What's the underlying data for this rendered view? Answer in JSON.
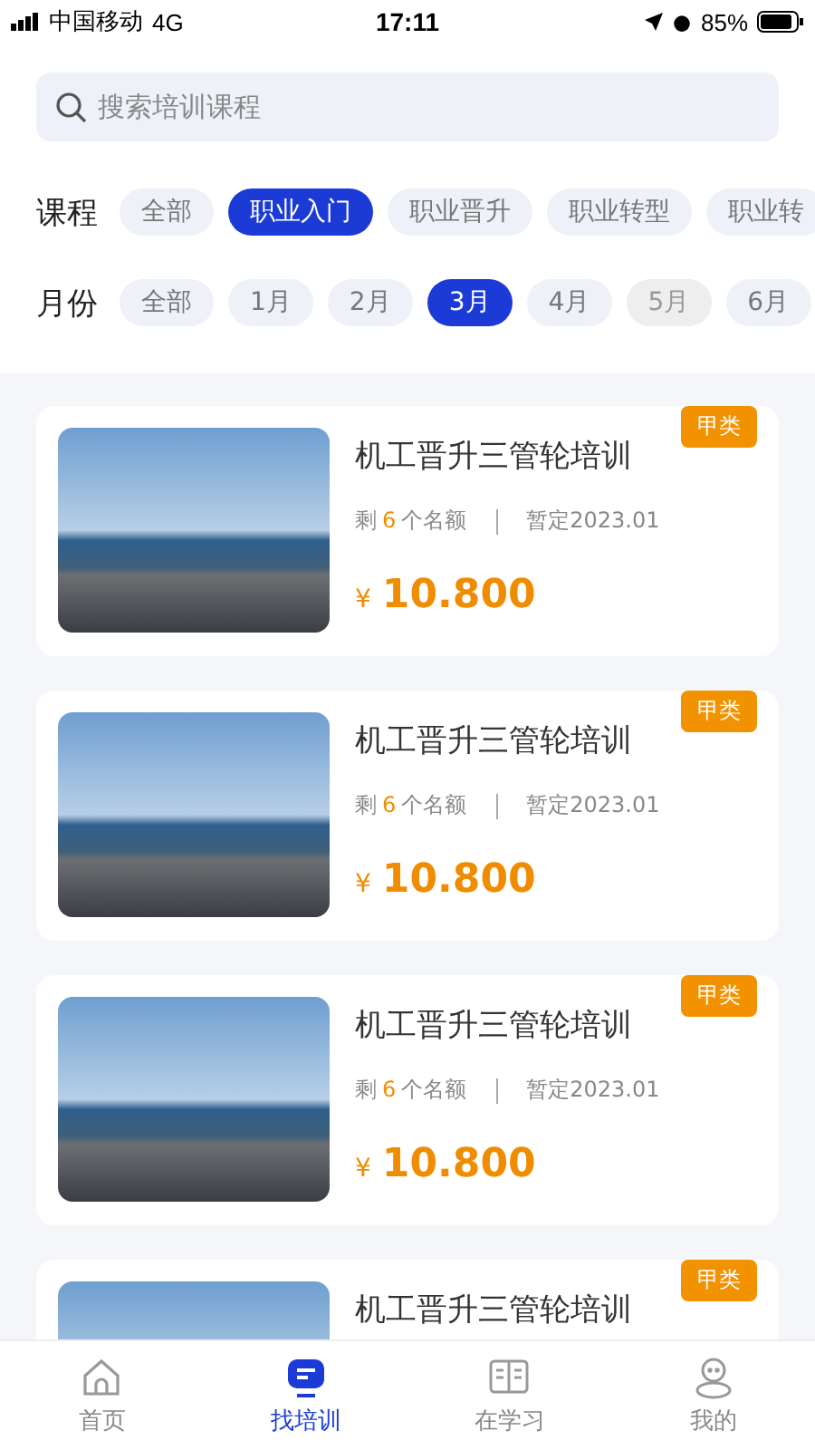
{
  "status_bar": {
    "carrier": "中国移动",
    "network": "4G",
    "time": "17:11",
    "battery": "85%"
  },
  "search": {
    "placeholder": "搜索培训课程"
  },
  "filters": [
    {
      "label": "课程",
      "options": [
        {
          "label": "全部",
          "selected": false,
          "disabled": false
        },
        {
          "label": "职业入门",
          "selected": true,
          "disabled": false
        },
        {
          "label": "职业晋升",
          "selected": false,
          "disabled": false
        },
        {
          "label": "职业转型",
          "selected": false,
          "disabled": false
        },
        {
          "label": "职业转",
          "selected": false,
          "disabled": false
        }
      ]
    },
    {
      "label": "月份",
      "options": [
        {
          "label": "全部",
          "selected": false,
          "disabled": false
        },
        {
          "label": "1月",
          "selected": false,
          "disabled": false
        },
        {
          "label": "2月",
          "selected": false,
          "disabled": false
        },
        {
          "label": "3月",
          "selected": true,
          "disabled": false
        },
        {
          "label": "4月",
          "selected": false,
          "disabled": false
        },
        {
          "label": "5月",
          "selected": false,
          "disabled": true
        },
        {
          "label": "6月",
          "selected": false,
          "disabled": false
        }
      ]
    }
  ],
  "courses": [
    {
      "tag": "甲类",
      "title": "机工晋升三管轮培训",
      "seats_prefix": "剩",
      "seats": "6",
      "seats_suffix": "个名额",
      "date": "暂定2023.01",
      "currency": "¥",
      "price": "10.800"
    },
    {
      "tag": "甲类",
      "title": "机工晋升三管轮培训",
      "seats_prefix": "剩",
      "seats": "6",
      "seats_suffix": "个名额",
      "date": "暂定2023.01",
      "currency": "¥",
      "price": "10.800"
    },
    {
      "tag": "甲类",
      "title": "机工晋升三管轮培训",
      "seats_prefix": "剩",
      "seats": "6",
      "seats_suffix": "个名额",
      "date": "暂定2023.01",
      "currency": "¥",
      "price": "10.800"
    },
    {
      "tag": "甲类",
      "title": "机工晋升三管轮培训"
    }
  ],
  "tab_bar": [
    {
      "label": "首页",
      "selected": false
    },
    {
      "label": "找培训",
      "selected": true
    },
    {
      "label": "在学习",
      "selected": false
    },
    {
      "label": "我的",
      "selected": false
    }
  ]
}
